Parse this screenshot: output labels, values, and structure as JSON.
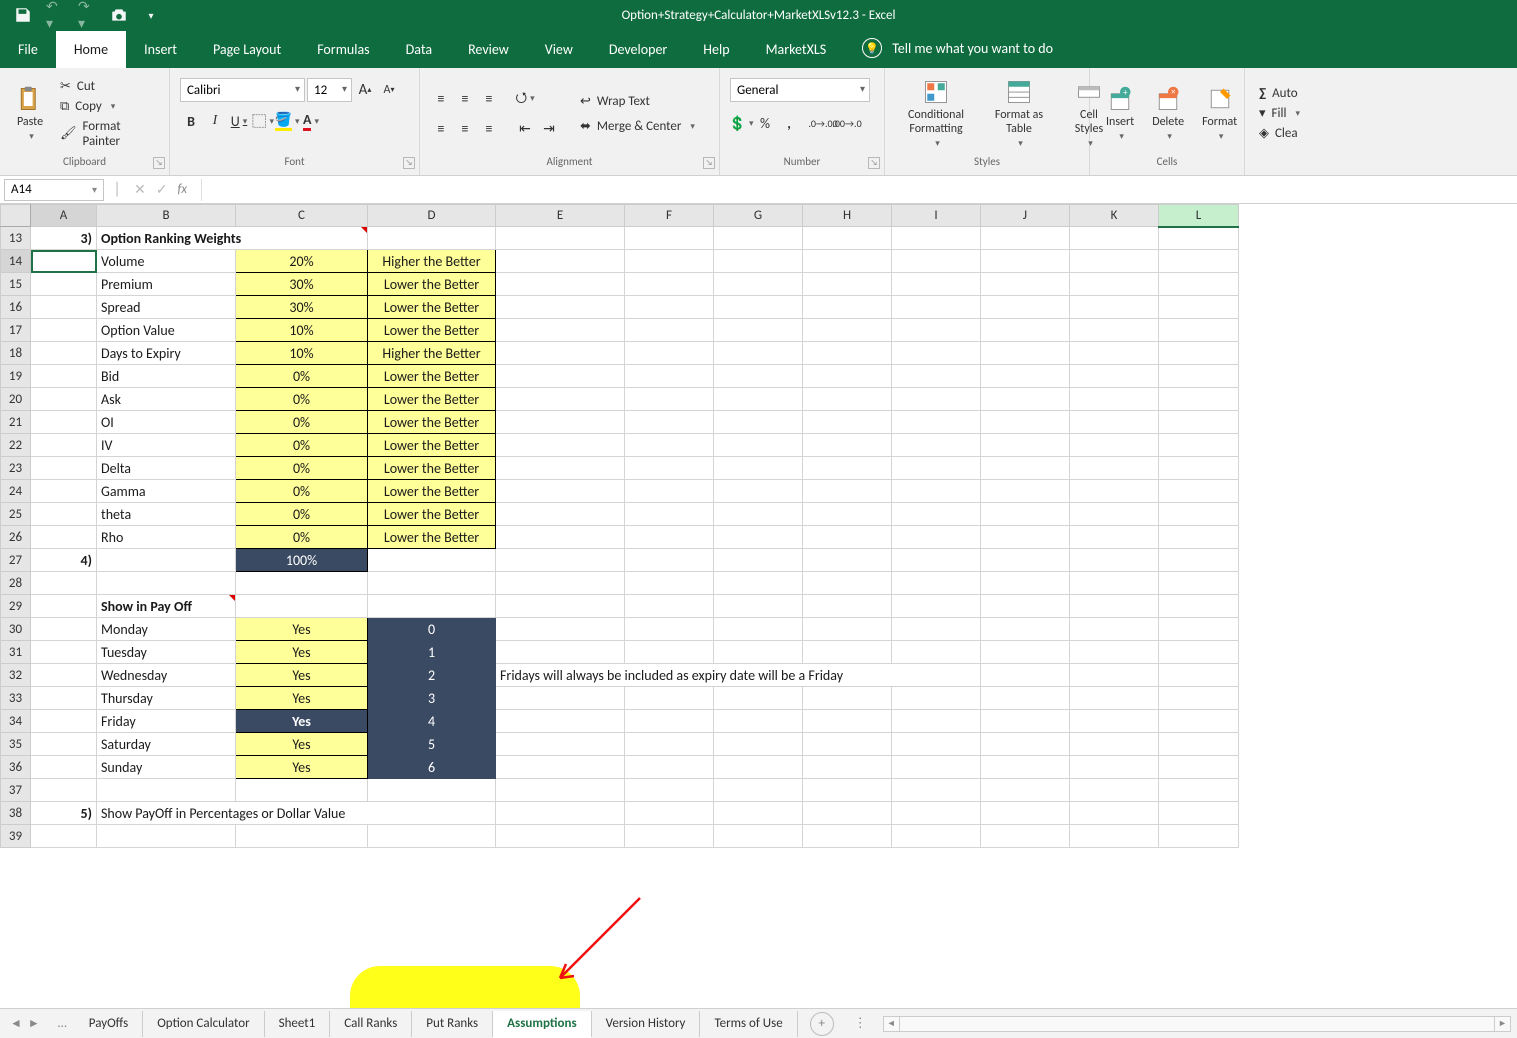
{
  "title": "Option+Strategy+Calculator+MarketXLSv12.3  -  Excel",
  "tabs": [
    "File",
    "Home",
    "Insert",
    "Page Layout",
    "Formulas",
    "Data",
    "Review",
    "View",
    "Developer",
    "Help",
    "MarketXLS"
  ],
  "activeTab": "Home",
  "tellMe": "Tell me what you want to do",
  "clipboard": {
    "cut": "Cut",
    "copy": "Copy",
    "painter": "Format Painter",
    "paste": "Paste",
    "label": "Clipboard"
  },
  "font": {
    "name": "Calibri",
    "size": "12",
    "label": "Font"
  },
  "alignment": {
    "wrap": "Wrap Text",
    "merge": "Merge & Center",
    "label": "Alignment"
  },
  "number": {
    "fmt": "General",
    "label": "Number"
  },
  "styles": {
    "cf": "Conditional Formatting",
    "fat": "Format as Table",
    "cs": "Cell Styles",
    "label": "Styles"
  },
  "cells": {
    "ins": "Insert",
    "del": "Delete",
    "fmt": "Format",
    "label": "Cells"
  },
  "editing": {
    "sum": "AutoSum",
    "fill": "Fill",
    "clear": "Clear"
  },
  "nameBox": "A14",
  "cols": [
    "A",
    "B",
    "C",
    "D",
    "E",
    "F",
    "G",
    "H",
    "I",
    "J",
    "K",
    "L"
  ],
  "section1": {
    "num": "3)",
    "title": "Option Ranking Weights"
  },
  "weights": [
    {
      "label": "Volume",
      "pct": "20%",
      "dir": "Higher the Better"
    },
    {
      "label": "Premium",
      "pct": "30%",
      "dir": "Lower the Better"
    },
    {
      "label": "Spread",
      "pct": "30%",
      "dir": "Lower the Better"
    },
    {
      "label": "Option Value",
      "pct": "10%",
      "dir": "Lower the Better"
    },
    {
      "label": "Days to Expiry",
      "pct": "10%",
      "dir": "Higher the Better"
    },
    {
      "label": "Bid",
      "pct": "0%",
      "dir": "Lower the Better"
    },
    {
      "label": "Ask",
      "pct": "0%",
      "dir": "Lower the Better"
    },
    {
      "label": "OI",
      "pct": "0%",
      "dir": "Lower the Better"
    },
    {
      "label": "IV",
      "pct": "0%",
      "dir": "Lower the Better"
    },
    {
      "label": "Delta",
      "pct": "0%",
      "dir": "Lower the Better"
    },
    {
      "label": "Gamma",
      "pct": "0%",
      "dir": "Lower the Better"
    },
    {
      "label": "theta",
      "pct": "0%",
      "dir": "Lower the Better"
    },
    {
      "label": "Rho",
      "pct": "0%",
      "dir": "Lower the Better"
    }
  ],
  "totalRow": {
    "num": "4)",
    "pct": "100%"
  },
  "section2": {
    "title": "Show in Pay Off"
  },
  "days": [
    {
      "label": "Monday",
      "val": "Yes",
      "idx": "0"
    },
    {
      "label": "Tuesday",
      "val": "Yes",
      "idx": "1"
    },
    {
      "label": "Wednesday",
      "val": "Yes",
      "idx": "2"
    },
    {
      "label": "Thursday",
      "val": "Yes",
      "idx": "3"
    },
    {
      "label": "Friday",
      "val": "Yes",
      "idx": "4",
      "dark": true
    },
    {
      "label": "Saturday",
      "val": "Yes",
      "idx": "5"
    },
    {
      "label": "Sunday",
      "val": "Yes",
      "idx": "6"
    }
  ],
  "fridayNote": "Fridays will always be included as expiry date will be a Friday",
  "section3": {
    "num": "5)",
    "title": "Show PayOff in Percentages or Dollar Value"
  },
  "sheetTabs": [
    "PayOffs",
    "Option Calculator",
    "Sheet1",
    "Call Ranks",
    "Put Ranks",
    "Assumptions",
    "Version History",
    "Terms of Use"
  ],
  "activeSheet": "Assumptions"
}
